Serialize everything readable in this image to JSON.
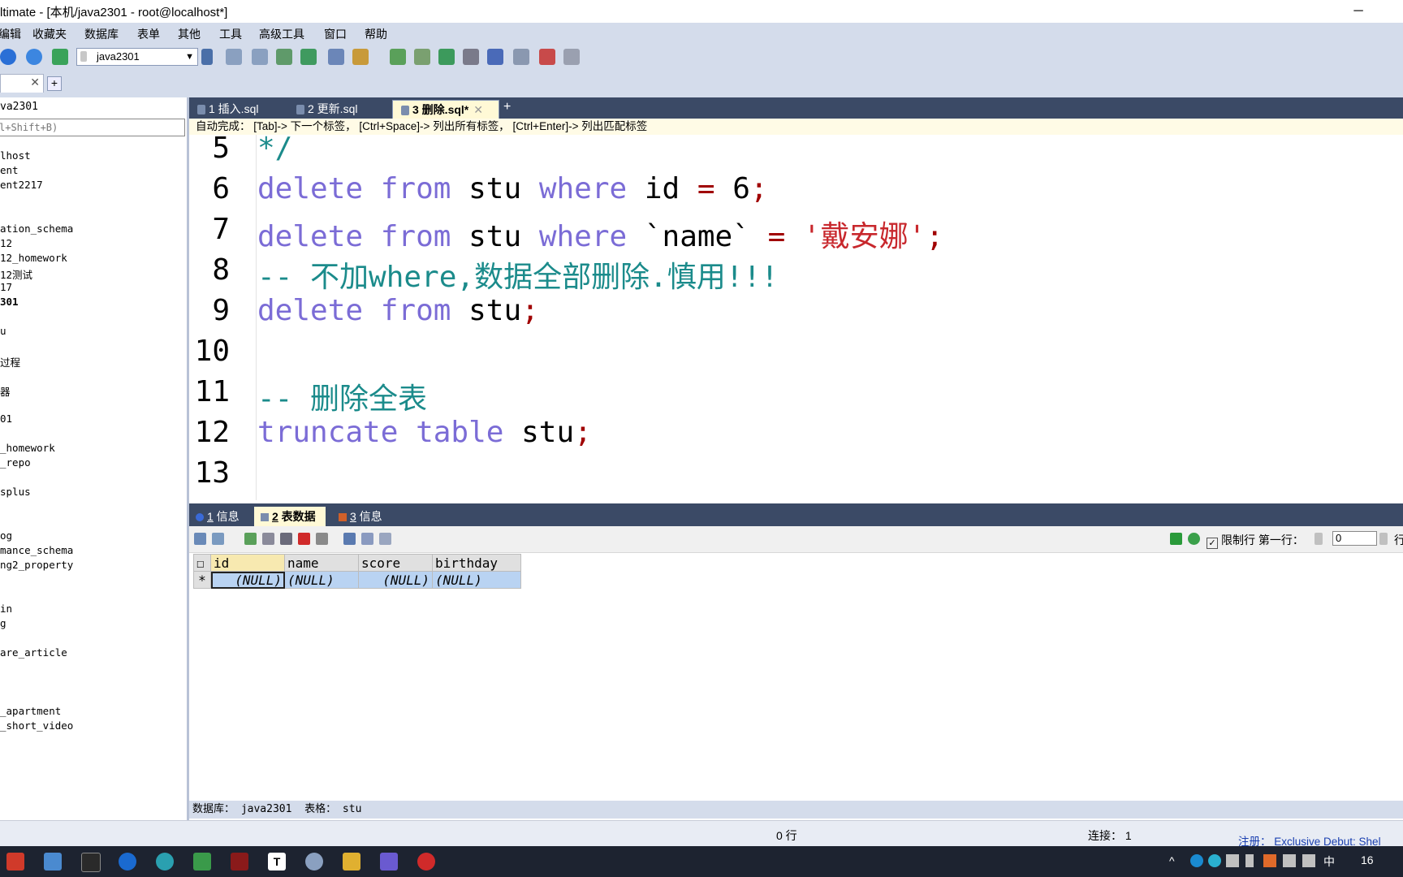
{
  "window": {
    "title": "ltimate - [本机/java2301 - root@localhost*]"
  },
  "menu": [
    "编辑",
    "收藏夹",
    "数据库",
    "表单",
    "其他",
    "工具",
    "高级工具",
    "窗口",
    "帮助"
  ],
  "toolbar": {
    "database_selected": "java2301"
  },
  "left_panel": {
    "header": "va2301",
    "filter_placeholder": "l+Shift+B)",
    "tree": [
      {
        "label": "lhost",
        "bold": false
      },
      {
        "label": "ent",
        "bold": false
      },
      {
        "label": "ent2217",
        "bold": false
      },
      {
        "label": "ation_schema",
        "bold": false
      },
      {
        "label": "12",
        "bold": false
      },
      {
        "label": "12_homework",
        "bold": false
      },
      {
        "label": "12测试",
        "bold": false
      },
      {
        "label": "17",
        "bold": false
      },
      {
        "label": "301",
        "bold": true
      },
      {
        "label": "u",
        "bold": false
      },
      {
        "label": "过程",
        "bold": false
      },
      {
        "label": "器",
        "bold": false
      },
      {
        "label": "01",
        "bold": false
      },
      {
        "label": "_homework",
        "bold": false
      },
      {
        "label": "_repo",
        "bold": false
      },
      {
        "label": "splus",
        "bold": false
      },
      {
        "label": "og",
        "bold": false
      },
      {
        "label": "mance_schema",
        "bold": false
      },
      {
        "label": "ng2_property",
        "bold": false
      },
      {
        "label": "in",
        "bold": false
      },
      {
        "label": "g",
        "bold": false
      },
      {
        "label": "are_article",
        "bold": false
      },
      {
        "label": "_apartment",
        "bold": false
      },
      {
        "label": "_short_video",
        "bold": false
      }
    ]
  },
  "editor_tabs": [
    {
      "label": "1 插入.sql",
      "active": false
    },
    {
      "label": "2 更新.sql",
      "active": false
    },
    {
      "label": "3 删除.sql*",
      "active": true
    }
  ],
  "autocomplete_hint": "自动完成： [Tab]-> 下一个标签， [Ctrl+Space]-> 列出所有标签， [Ctrl+Enter]-> 列出匹配标签",
  "editor": {
    "lines": [
      {
        "n": "5",
        "tokens": [
          {
            "c": "cm",
            "t": "*/"
          }
        ]
      },
      {
        "n": "6",
        "tokens": [
          {
            "c": "kw",
            "t": "delete"
          },
          {
            "c": "",
            "t": " "
          },
          {
            "c": "kw",
            "t": "from"
          },
          {
            "c": "",
            "t": " stu "
          },
          {
            "c": "kw",
            "t": "where"
          },
          {
            "c": "",
            "t": " id "
          },
          {
            "c": "op",
            "t": "="
          },
          {
            "c": "",
            "t": " 6"
          },
          {
            "c": "pu",
            "t": ";"
          }
        ]
      },
      {
        "n": "7",
        "tokens": [
          {
            "c": "kw",
            "t": "delete"
          },
          {
            "c": "",
            "t": " "
          },
          {
            "c": "kw",
            "t": "from"
          },
          {
            "c": "",
            "t": " stu "
          },
          {
            "c": "kw",
            "t": "where"
          },
          {
            "c": "",
            "t": " `name` "
          },
          {
            "c": "op",
            "t": "="
          },
          {
            "c": "",
            "t": " "
          },
          {
            "c": "st",
            "t": "'戴安娜'"
          },
          {
            "c": "pu",
            "t": ";"
          }
        ]
      },
      {
        "n": "8",
        "tokens": [
          {
            "c": "cm",
            "t": "-- 不加where,数据全部删除.慎用!!!"
          }
        ]
      },
      {
        "n": "9",
        "tokens": [
          {
            "c": "kw",
            "t": "delete"
          },
          {
            "c": "",
            "t": " "
          },
          {
            "c": "kw",
            "t": "from"
          },
          {
            "c": "",
            "t": " stu"
          },
          {
            "c": "pu",
            "t": ";"
          }
        ]
      },
      {
        "n": "10",
        "tokens": []
      },
      {
        "n": "11",
        "tokens": [
          {
            "c": "cm",
            "t": "-- 删除全表"
          }
        ]
      },
      {
        "n": "12",
        "tokens": [
          {
            "c": "kw",
            "t": "truncate"
          },
          {
            "c": "",
            "t": " "
          },
          {
            "c": "kw",
            "t": "table"
          },
          {
            "c": "",
            "t": " stu"
          },
          {
            "c": "pu",
            "t": ";"
          }
        ]
      },
      {
        "n": "13",
        "tokens": []
      }
    ]
  },
  "result_tabs": [
    {
      "num": "1",
      "label": " 信息",
      "active": false
    },
    {
      "num": "2",
      "label": " 表数据",
      "active": true
    },
    {
      "num": "3",
      "label": " 信息",
      "active": false
    }
  ],
  "result_toolbar": {
    "limit_label": "限制行",
    "first_row_label": "第一行：",
    "first_row_value": "0",
    "rows_suffix": "行"
  },
  "grid": {
    "columns": [
      "id",
      "name",
      "score",
      "birthday"
    ],
    "row_marker": "*",
    "rows": [
      [
        "(NULL)",
        "(NULL)",
        "(NULL)",
        "(NULL)"
      ]
    ]
  },
  "db_status": "数据库： java2301  表格： stu",
  "statusbar": {
    "rows": "0 行",
    "connection": "连接： 1",
    "registration": "注册： Exclusive Debut: Shel"
  },
  "taskbar": {
    "ime": "中",
    "clock": "16"
  },
  "colors": {
    "keyword": "#7b6cd6",
    "comment": "#1b8b8b",
    "string": "#c8282d",
    "punct": "#a00000"
  }
}
